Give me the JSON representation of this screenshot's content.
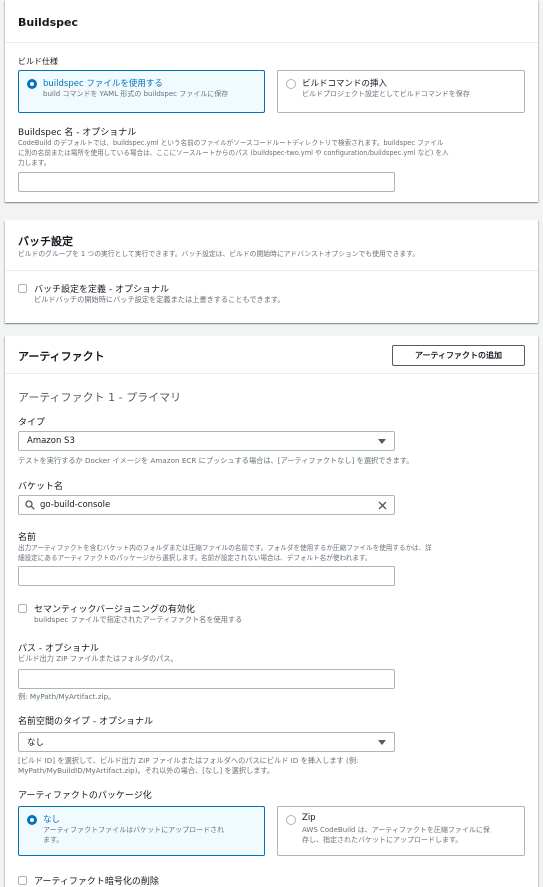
{
  "buildspec": {
    "title": "Buildspec",
    "spec_label": "ビルド仕様",
    "options": [
      {
        "title": "buildspec ファイルを使用する",
        "desc": "build コマンドを YAML 形式の buildspec ファイルに保存",
        "selected": true
      },
      {
        "title": "ビルドコマンドの挿入",
        "desc": "ビルドプロジェクト設定としてビルドコマンドを保存",
        "selected": false
      }
    ],
    "name_label": "Buildspec 名 - オプショナル",
    "name_desc_1": "CodeBuild のデフォルトでは、buildspec.yml という名前のファイルがソースコードルートディレクトリで検索されます。buildspec ファイル",
    "name_desc_2": "に別の名前または場所を使用している場合は、ここにソースルートからのパス (buildspec-two.yml や configuration/buildspec.yml など) を入",
    "name_desc_3": "力します。",
    "name_value": ""
  },
  "batch": {
    "title": "バッチ設定",
    "desc": "ビルドのグループを 1 つの実行として実行できます。バッチ設定は、ビルドの開始時にアドバンストオプションでも使用できます。",
    "checkbox_label": "バッチ設定を定義 - オプショナル",
    "checkbox_desc": "ビルドバッチの開始時にバッチ設定を定義または上書きすることもできます。"
  },
  "artifacts": {
    "title": "アーティファクト",
    "add_button": "アーティファクトの追加",
    "subtitle": "アーティファクト 1 - プライマリ",
    "type_label": "タイプ",
    "type_value": "Amazon S3",
    "type_desc": "テストを実行するか Docker イメージを Amazon ECR にプッシュする場合は、[アーティファクトなし] を選択できます。",
    "bucket_label": "バケット名",
    "bucket_value": "go-build-console",
    "name_label": "名前",
    "name_desc_1": "出力アーティファクトを含むバケット内のフォルダまたは圧縮ファイルの名前です。フォルダを使用するか圧縮ファイルを使用するかは、詳",
    "name_desc_2": "細設定にあるアーティファクトのパッケージから選択します。名前が設定されない場合は、デフォルト名が使われます。",
    "name_value": "",
    "semver_label": "セマンティックバージョニングの有効化",
    "semver_desc": "buildspec ファイルで指定されたアーティファクト名を使用する",
    "path_label": "パス - オプショナル",
    "path_desc": "ビルド出力 ZIP ファイルまたはフォルダのパス。",
    "path_value": "",
    "path_example": "例: MyPath/MyArtifact.zip。",
    "ns_label": "名前空間のタイプ - オプショナル",
    "ns_value": "なし",
    "ns_desc_1": "[ビルド ID] を選択して、ビルド出力 ZIP ファイルまたはフォルダへのパスにビルド ID を挿入します (例:",
    "ns_desc_2": "MyPath/MyBuildID/MyArtifact.zip)。それ以外の場合、[なし] を選択します。",
    "packaging_label": "アーティファクトのパッケージ化",
    "packaging_options": [
      {
        "title": "なし",
        "desc_1": "アーティファクトファイルはバケットにアップロードされ",
        "desc_2": "ます。",
        "selected": true
      },
      {
        "title": "Zip",
        "desc_1": "AWS CodeBuild は、アーティファクトを圧縮ファイルに保",
        "desc_2": "存し、指定されたバケットにアップロードします。",
        "selected": false
      }
    ],
    "encrypt_label": "アーティファクト暗号化の削除"
  }
}
